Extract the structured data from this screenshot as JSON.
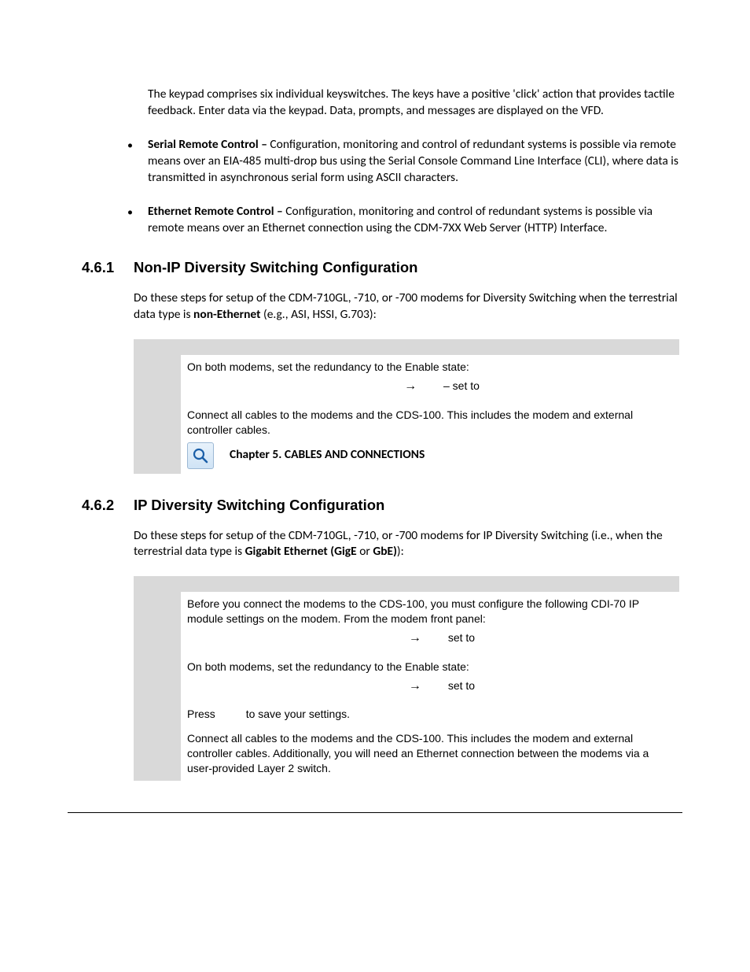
{
  "intro_para": "The keypad comprises six individual keyswitches. The keys have a positive 'click' action that provides tactile feedback. Enter data via the keypad. Data, prompts, and messages are displayed on the VFD.",
  "bullets": [
    {
      "lead": "Serial Remote Control – ",
      "body": "Configuration, monitoring and control of redundant systems is possible via remote means over an EIA-485 multi-drop bus using the Serial Console Command Line Interface (CLI), where data is transmitted in asynchronous serial form using ASCII characters."
    },
    {
      "lead": "Ethernet Remote Control – ",
      "body": "Configuration, monitoring and control of redundant systems is possible via remote means over an Ethernet connection using the CDM-7XX Web Server (HTTP) Interface."
    }
  ],
  "sec1": {
    "num": "4.6.1",
    "title": "Non-IP Diversity Switching Configuration",
    "para_pre": "Do these steps for setup of the CDM-710GL, -710, or -700 modems for Diversity Switching when the terrestrial data type is ",
    "para_bold": "non-Ethernet",
    "para_post": " (e.g., ASI, HSSI, G.703):",
    "row1": "On both modems, set the redundancy to the Enable state:",
    "row1_setto": "– set to",
    "row2": "Connect all cables to the modems and the CDS-100. This includes the modem and external controller cables.",
    "chapter_ref": "Chapter 5. CABLES AND CONNECTIONS"
  },
  "sec2": {
    "num": "4.6.2",
    "title": "IP Diversity Switching Configuration",
    "para_pre": "Do these steps for setup of the CDM-710GL, -710, or -700 modems for IP Diversity Switching (i.e., when the terrestrial data type is ",
    "para_bold": "Gigabit Ethernet (GigE",
    "para_mid": " or ",
    "para_bold2": "GbE)",
    "para_post": "):",
    "row1": "Before you connect the modems to the CDS-100, you must configure the following CDI-70 IP module settings on the modem. From the modem front panel:",
    "row1_setto": "set to",
    "row2": "On both modems, set the redundancy to the Enable state:",
    "row2_setto": "set to",
    "row3_pre": "Press ",
    "row3_post": " to save your settings.",
    "row4": "Connect all cables to the modems and the CDS-100. This includes the modem and external controller cables. Additionally, you will need an Ethernet connection between the modems via a user-provided Layer 2 switch."
  }
}
